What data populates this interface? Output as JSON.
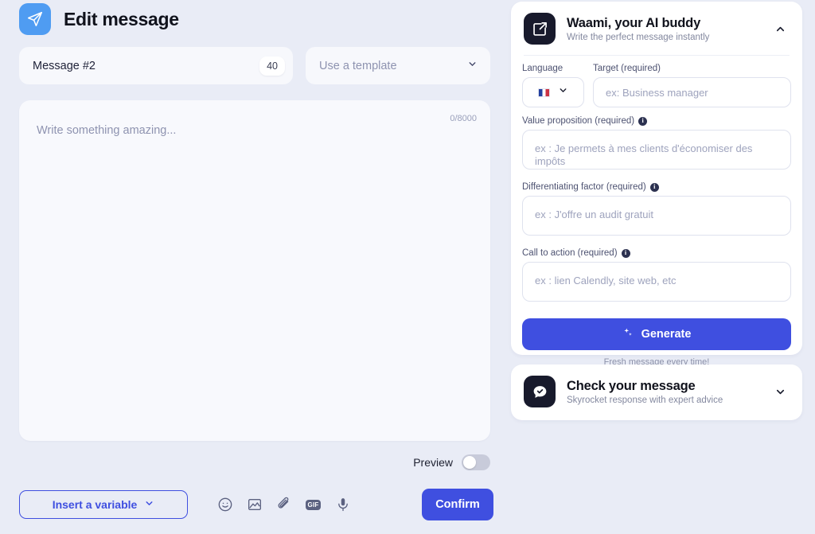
{
  "header": {
    "title": "Edit message",
    "icon": "send-plane-icon"
  },
  "message_name": {
    "value": "Message #2",
    "char_count": "40"
  },
  "template_select": {
    "placeholder": "Use a template",
    "chevron": "chevron-down-icon"
  },
  "editor": {
    "placeholder": "Write something amazing...",
    "counter": "0/8000"
  },
  "preview": {
    "label": "Preview",
    "enabled": false
  },
  "bottom_bar": {
    "insert_variable_label": "Insert a variable",
    "tools": [
      {
        "name": "emoji-icon",
        "label": "Emoji"
      },
      {
        "name": "image-icon",
        "label": "Image"
      },
      {
        "name": "attachment-icon",
        "label": "Attachment"
      },
      {
        "name": "gif-icon",
        "label": "GIF"
      },
      {
        "name": "microphone-icon",
        "label": "Voice note"
      }
    ],
    "confirm_label": "Confirm"
  },
  "waami": {
    "title": "Waami, your AI buddy",
    "subtitle": "Write the perfect message instantly",
    "icon": "edit-square-icon",
    "collapse_icon": "chevron-up-icon",
    "language": {
      "label": "Language",
      "flag": "french-flag",
      "chevron": "chevron-down-icon"
    },
    "target": {
      "label": "Target (required)",
      "placeholder": "ex: Business manager"
    },
    "value_proposition": {
      "label": "Value proposition (required)",
      "info": "i",
      "placeholder": "ex : Je permets à mes clients d'économiser des impôts"
    },
    "differentiating_factor": {
      "label": "Differentiating factor (required)",
      "info": "i",
      "placeholder": "ex : J'offre un audit gratuit"
    },
    "call_to_action": {
      "label": "Call to action (required)",
      "info": "i",
      "placeholder": "ex : lien Calendly, site web, etc"
    },
    "generate_label": "Generate",
    "generate_caption": "Fresh message every time!"
  },
  "check_message": {
    "title": "Check your message",
    "subtitle": "Skyrocket response with expert advice",
    "icon": "chat-check-icon",
    "expand_icon": "chevron-down-icon"
  },
  "colors": {
    "page_background": "#e9ecf6",
    "accent_blue": "#3f4fe0",
    "header_icon_blue": "#4f9cf2",
    "card_dark": "#181a2c"
  }
}
